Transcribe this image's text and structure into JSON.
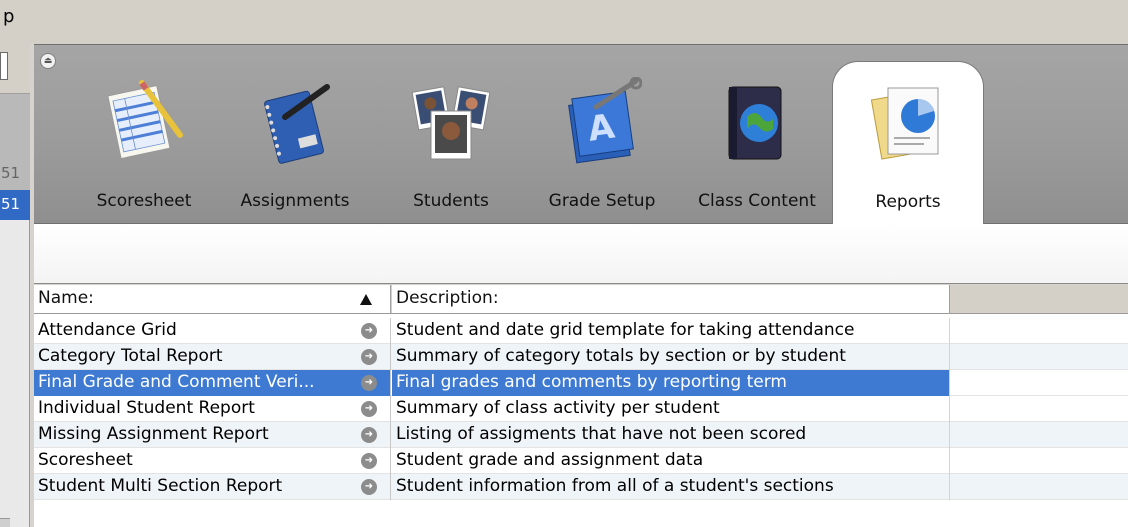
{
  "topbar": {
    "menu_fragment": "p"
  },
  "leftstrip": {
    "row1": "51",
    "row2": "51"
  },
  "toolbar": {
    "eject_glyph": "⏏",
    "tools": [
      {
        "label": "Scoresheet",
        "icon": "scoresheet-icon"
      },
      {
        "label": "Assignments",
        "icon": "notebook-pen-icon"
      },
      {
        "label": "Students",
        "icon": "student-photos-icon"
      },
      {
        "label": "Grade Setup",
        "icon": "grade-setup-icon"
      },
      {
        "label": "Class Content",
        "icon": "globe-book-icon"
      },
      {
        "label": "Reports",
        "icon": "reports-chart-icon",
        "active": true
      }
    ]
  },
  "grid": {
    "headers": {
      "name": "Name:",
      "description": "Description:"
    },
    "rows": [
      {
        "name": "Attendance Grid",
        "description": "Student and date grid template for taking attendance"
      },
      {
        "name": "Category Total Report",
        "description": "Summary of category totals by section or by student"
      },
      {
        "name": "Final Grade and Comment Veri...",
        "description": "Final grades and comments by reporting term",
        "selected": true
      },
      {
        "name": "Individual Student Report",
        "description": "Summary of class activity per student"
      },
      {
        "name": "Missing Assignment Report",
        "description": "Listing of assigments that have not been scored"
      },
      {
        "name": "Scoresheet",
        "description": "Student grade and assignment data"
      },
      {
        "name": "Student Multi Section Report",
        "description": "Student information from all of a student's sections"
      }
    ]
  },
  "colors": {
    "selection": "#3e7ad1",
    "toolbar_bg": "#9a9a9a"
  }
}
